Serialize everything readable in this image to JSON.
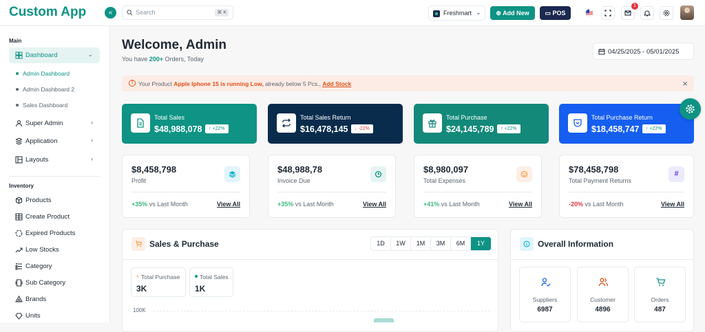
{
  "app": {
    "title": "Custom App"
  },
  "header": {
    "search_placeholder": "Search",
    "search_shortcut": "⌘ K",
    "store": "Freshmart",
    "add_new": "Add New",
    "pos": "POS",
    "notification_count": "1"
  },
  "sidebar": {
    "main_label": "Main",
    "dashboard": "Dashboard",
    "subitems": [
      "Admin Dashboard",
      "Admin Dashboard 2",
      "Sales Dashboard"
    ],
    "items": [
      "Super Admin",
      "Application",
      "Layouts"
    ],
    "inventory_label": "Inventory",
    "inventory": [
      "Products",
      "Create Product",
      "Expired Products",
      "Low Stocks",
      "Category",
      "Sub Category",
      "Brands",
      "Units"
    ]
  },
  "welcome": {
    "title": "Welcome, Admin",
    "prefix": "You have ",
    "count": "200+",
    "suffix": " Orders, Today"
  },
  "date_range": "04/25/2025 - 05/01/2025",
  "alert": {
    "pre": "Your Product ",
    "product": "Apple Iphone 15 is running Low,",
    "mid": " already below 5 Pcs., ",
    "link": "Add Stock"
  },
  "stat_cards": [
    {
      "label": "Total Sales",
      "value": "$48,988,078",
      "change": "+22%",
      "color": "#0e9384",
      "icon": "file-icon"
    },
    {
      "label": "Total Sales Return",
      "value": "$16,478,145",
      "change": "-22%",
      "color": "#092c4c",
      "icon": "repeat-icon"
    },
    {
      "label": "Total Purchase",
      "value": "$24,145,789",
      "change": "+22%",
      "color": "#13897a",
      "icon": "gift-icon"
    },
    {
      "label": "Total Purchase Return",
      "value": "$18,458,747",
      "change": "+22%",
      "color": "#155eef",
      "icon": "shield-icon"
    }
  ],
  "metric_cards": [
    {
      "value": "$8,458,798",
      "label": "Profit",
      "change": "+35%",
      "suffix": " vs Last Month",
      "link": "View All"
    },
    {
      "value": "$48,988,78",
      "label": "Invoice Due",
      "change": "+35%",
      "suffix": " vs Last Month",
      "link": "View All"
    },
    {
      "value": "$8,980,097",
      "label": "Total Expenses",
      "change": "+41%",
      "suffix": " vs Last Month",
      "link": "View All"
    },
    {
      "value": "$78,458,798",
      "label": "Total Payment Returns",
      "change": "-20%",
      "suffix": " vs Last Month",
      "link": "View All"
    }
  ],
  "sales_purchase": {
    "title": "Sales & Purchase",
    "ranges": [
      "1D",
      "1W",
      "1M",
      "3M",
      "6M",
      "1Y"
    ],
    "active_range": "1Y",
    "legend": [
      {
        "name": "Total Purchase",
        "value": "3K"
      },
      {
        "name": "Total Sales",
        "value": "1K"
      }
    ],
    "ytick": "100K"
  },
  "overall": {
    "title": "Overall Information",
    "items": [
      {
        "label": "Suppliers",
        "value": "6987"
      },
      {
        "label": "Customer",
        "value": "4896"
      },
      {
        "label": "Orders",
        "value": "487"
      }
    ]
  }
}
